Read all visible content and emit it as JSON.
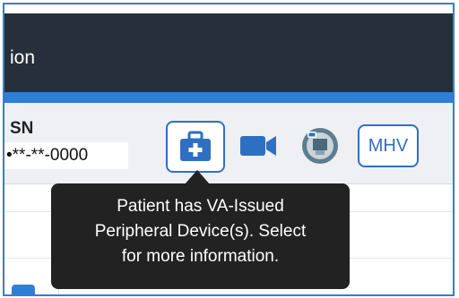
{
  "header": {
    "title_fragment": "ion"
  },
  "patient": {
    "ssn_label": "SN",
    "ssn_value": "•**-**-0000"
  },
  "actions": {
    "device_icon": "medical-bag-icon",
    "video_icon": "video-camera-icon",
    "seal_icon": "va-seal-icon",
    "mhv_label": "MHV"
  },
  "tooltip": {
    "line1": "Patient has VA-Issued",
    "line2": "Peripheral Device(s). Select",
    "line3": "for more information."
  },
  "colors": {
    "header_bg": "#27303a",
    "accent_blue": "#2f7fd6",
    "button_border": "#2f6fc1",
    "tooltip_bg": "#222222"
  }
}
